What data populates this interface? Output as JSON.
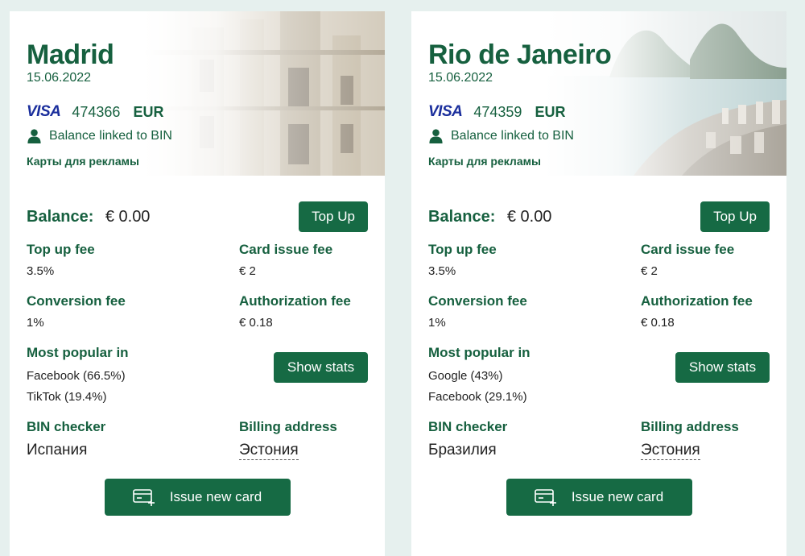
{
  "cards": [
    {
      "city": "Madrid",
      "date": "15.06.2022",
      "network": "VISA",
      "bin": "474366",
      "currency": "EUR",
      "balance_link": "Balance linked to BIN",
      "tag": "Карты для рекламы",
      "balance_label": "Balance:",
      "balance_value": "€ 0.00",
      "topup_label": "Top Up",
      "fees": {
        "topup_label": "Top up fee",
        "topup_value": "3.5%",
        "issue_label": "Card issue fee",
        "issue_value": "€ 2",
        "conversion_label": "Conversion fee",
        "conversion_value": "1%",
        "auth_label": "Authorization fee",
        "auth_value": "€ 0.18"
      },
      "popular_label": "Most popular in",
      "popular": [
        "Facebook (66.5%)",
        "TikTok (19.4%)"
      ],
      "stats_label": "Show stats",
      "bin_checker_label": "BIN checker",
      "bin_checker_value": "Испания",
      "billing_label": "Billing address",
      "billing_value": "Эстония",
      "issue_label": "Issue new card"
    },
    {
      "city": "Rio de Janeiro",
      "date": "15.06.2022",
      "network": "VISA",
      "bin": "474359",
      "currency": "EUR",
      "balance_link": "Balance linked to BIN",
      "tag": "Карты для рекламы",
      "balance_label": "Balance:",
      "balance_value": "€ 0.00",
      "topup_label": "Top Up",
      "fees": {
        "topup_label": "Top up fee",
        "topup_value": "3.5%",
        "issue_label": "Card issue fee",
        "issue_value": "€ 2",
        "conversion_label": "Conversion fee",
        "conversion_value": "1%",
        "auth_label": "Authorization fee",
        "auth_value": "€ 0.18"
      },
      "popular_label": "Most popular in",
      "popular": [
        "Google (43%)",
        "Facebook (29.1%)"
      ],
      "stats_label": "Show stats",
      "bin_checker_label": "BIN checker",
      "bin_checker_value": "Бразилия",
      "billing_label": "Billing address",
      "billing_value": "Эстония",
      "issue_label": "Issue new card"
    }
  ],
  "colors": {
    "brand_green": "#166a44",
    "heading_green": "#16603f",
    "visa_blue": "#1a2e9c",
    "page_bg": "#e6f0ee"
  },
  "icons": [
    "person-icon",
    "card-plus-icon"
  ]
}
